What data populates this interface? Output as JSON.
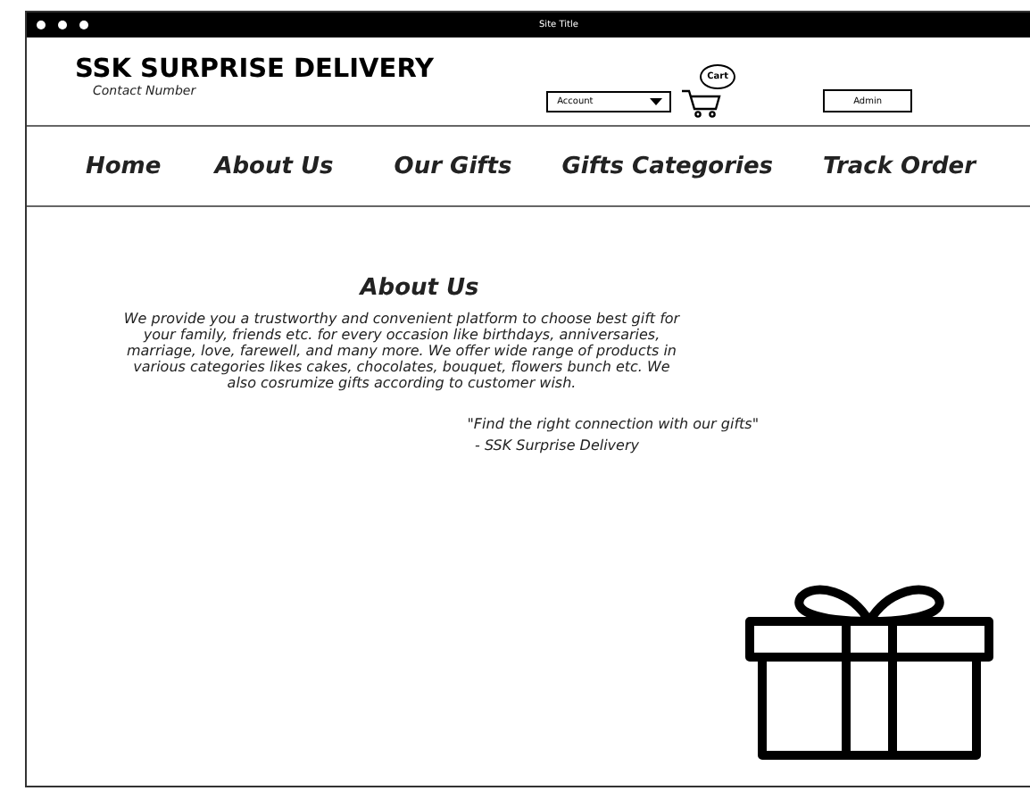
{
  "window": {
    "title": "Site Title"
  },
  "header": {
    "brand": "SSK SURPRISE DELIVERY",
    "contact": "Contact Number",
    "account_dropdown": "Account",
    "cart_label": "Cart",
    "admin_button": "Admin"
  },
  "nav": [
    "Home",
    "About Us",
    "Our Gifts",
    "Gifts Categories",
    "Track Order"
  ],
  "about": {
    "heading": "About Us",
    "text": "We provide you a trustworthy and convenient platform to choose best gift for your family, friends etc. for every occasion like birthdays, anniversaries, marriage, love, farewell, and many more. We offer wide range of products in various categories likes cakes, chocolates, bouquet, flowers bunch etc. We also cosrumize gifts according to customer wish.",
    "quote": "\"Find the right connection with our gifts\"",
    "quote_author": "- SSK Surprise Delivery"
  }
}
